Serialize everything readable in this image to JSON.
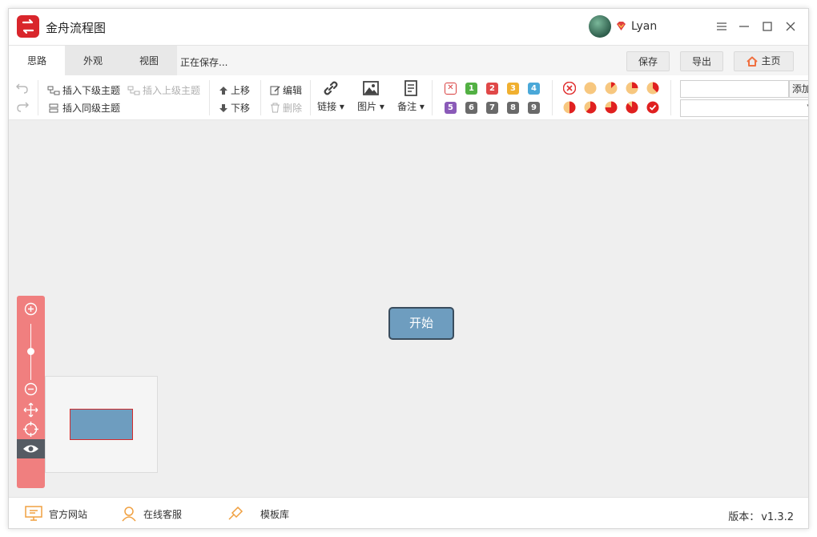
{
  "app": {
    "title": "金舟流程图",
    "user_name": "Lyan"
  },
  "tabs": [
    {
      "label": "思路"
    },
    {
      "label": "外观"
    },
    {
      "label": "视图"
    }
  ],
  "status": {
    "saving": "正在保存..."
  },
  "top_buttons": {
    "save": "保存",
    "export": "导出",
    "home": "主页"
  },
  "ribbon": {
    "insert_child": "插入下级主题",
    "insert_parent": "插入上级主题",
    "insert_sibling": "插入同级主题",
    "move_up": "上移",
    "move_down": "下移",
    "edit": "编辑",
    "delete": "删除",
    "link": "链接",
    "image": "图片",
    "note": "备注",
    "priorities": [
      {
        "label": "",
        "color": "#d94040"
      },
      {
        "label": "1",
        "color": "#52b043"
      },
      {
        "label": "2",
        "color": "#e04848"
      },
      {
        "label": "3",
        "color": "#f0b030"
      },
      {
        "label": "4",
        "color": "#4aa8d8"
      },
      {
        "label": "5",
        "color": "#8a5ab8"
      },
      {
        "label": "6",
        "color": "#6a6a6a"
      },
      {
        "label": "7",
        "color": "#6a6a6a"
      },
      {
        "label": "8",
        "color": "#6a6a6a"
      },
      {
        "label": "9",
        "color": "#6a6a6a"
      }
    ],
    "progress": [
      0,
      0,
      0.125,
      0.25,
      0.375,
      0.5,
      0.625,
      0.75,
      0.875,
      1
    ],
    "add_label": "添加"
  },
  "canvas": {
    "start_node": "开始"
  },
  "footer": {
    "website": "官方网站",
    "support": "在线客服",
    "templates": "模板库",
    "version_label": "版本：",
    "version_value": "v1.3.2"
  },
  "colors": {
    "accent_red": "#d9262c",
    "zoom_bar": "#f07f7f",
    "node_fill": "#6e9dbf",
    "home_icon": "#f07040"
  }
}
